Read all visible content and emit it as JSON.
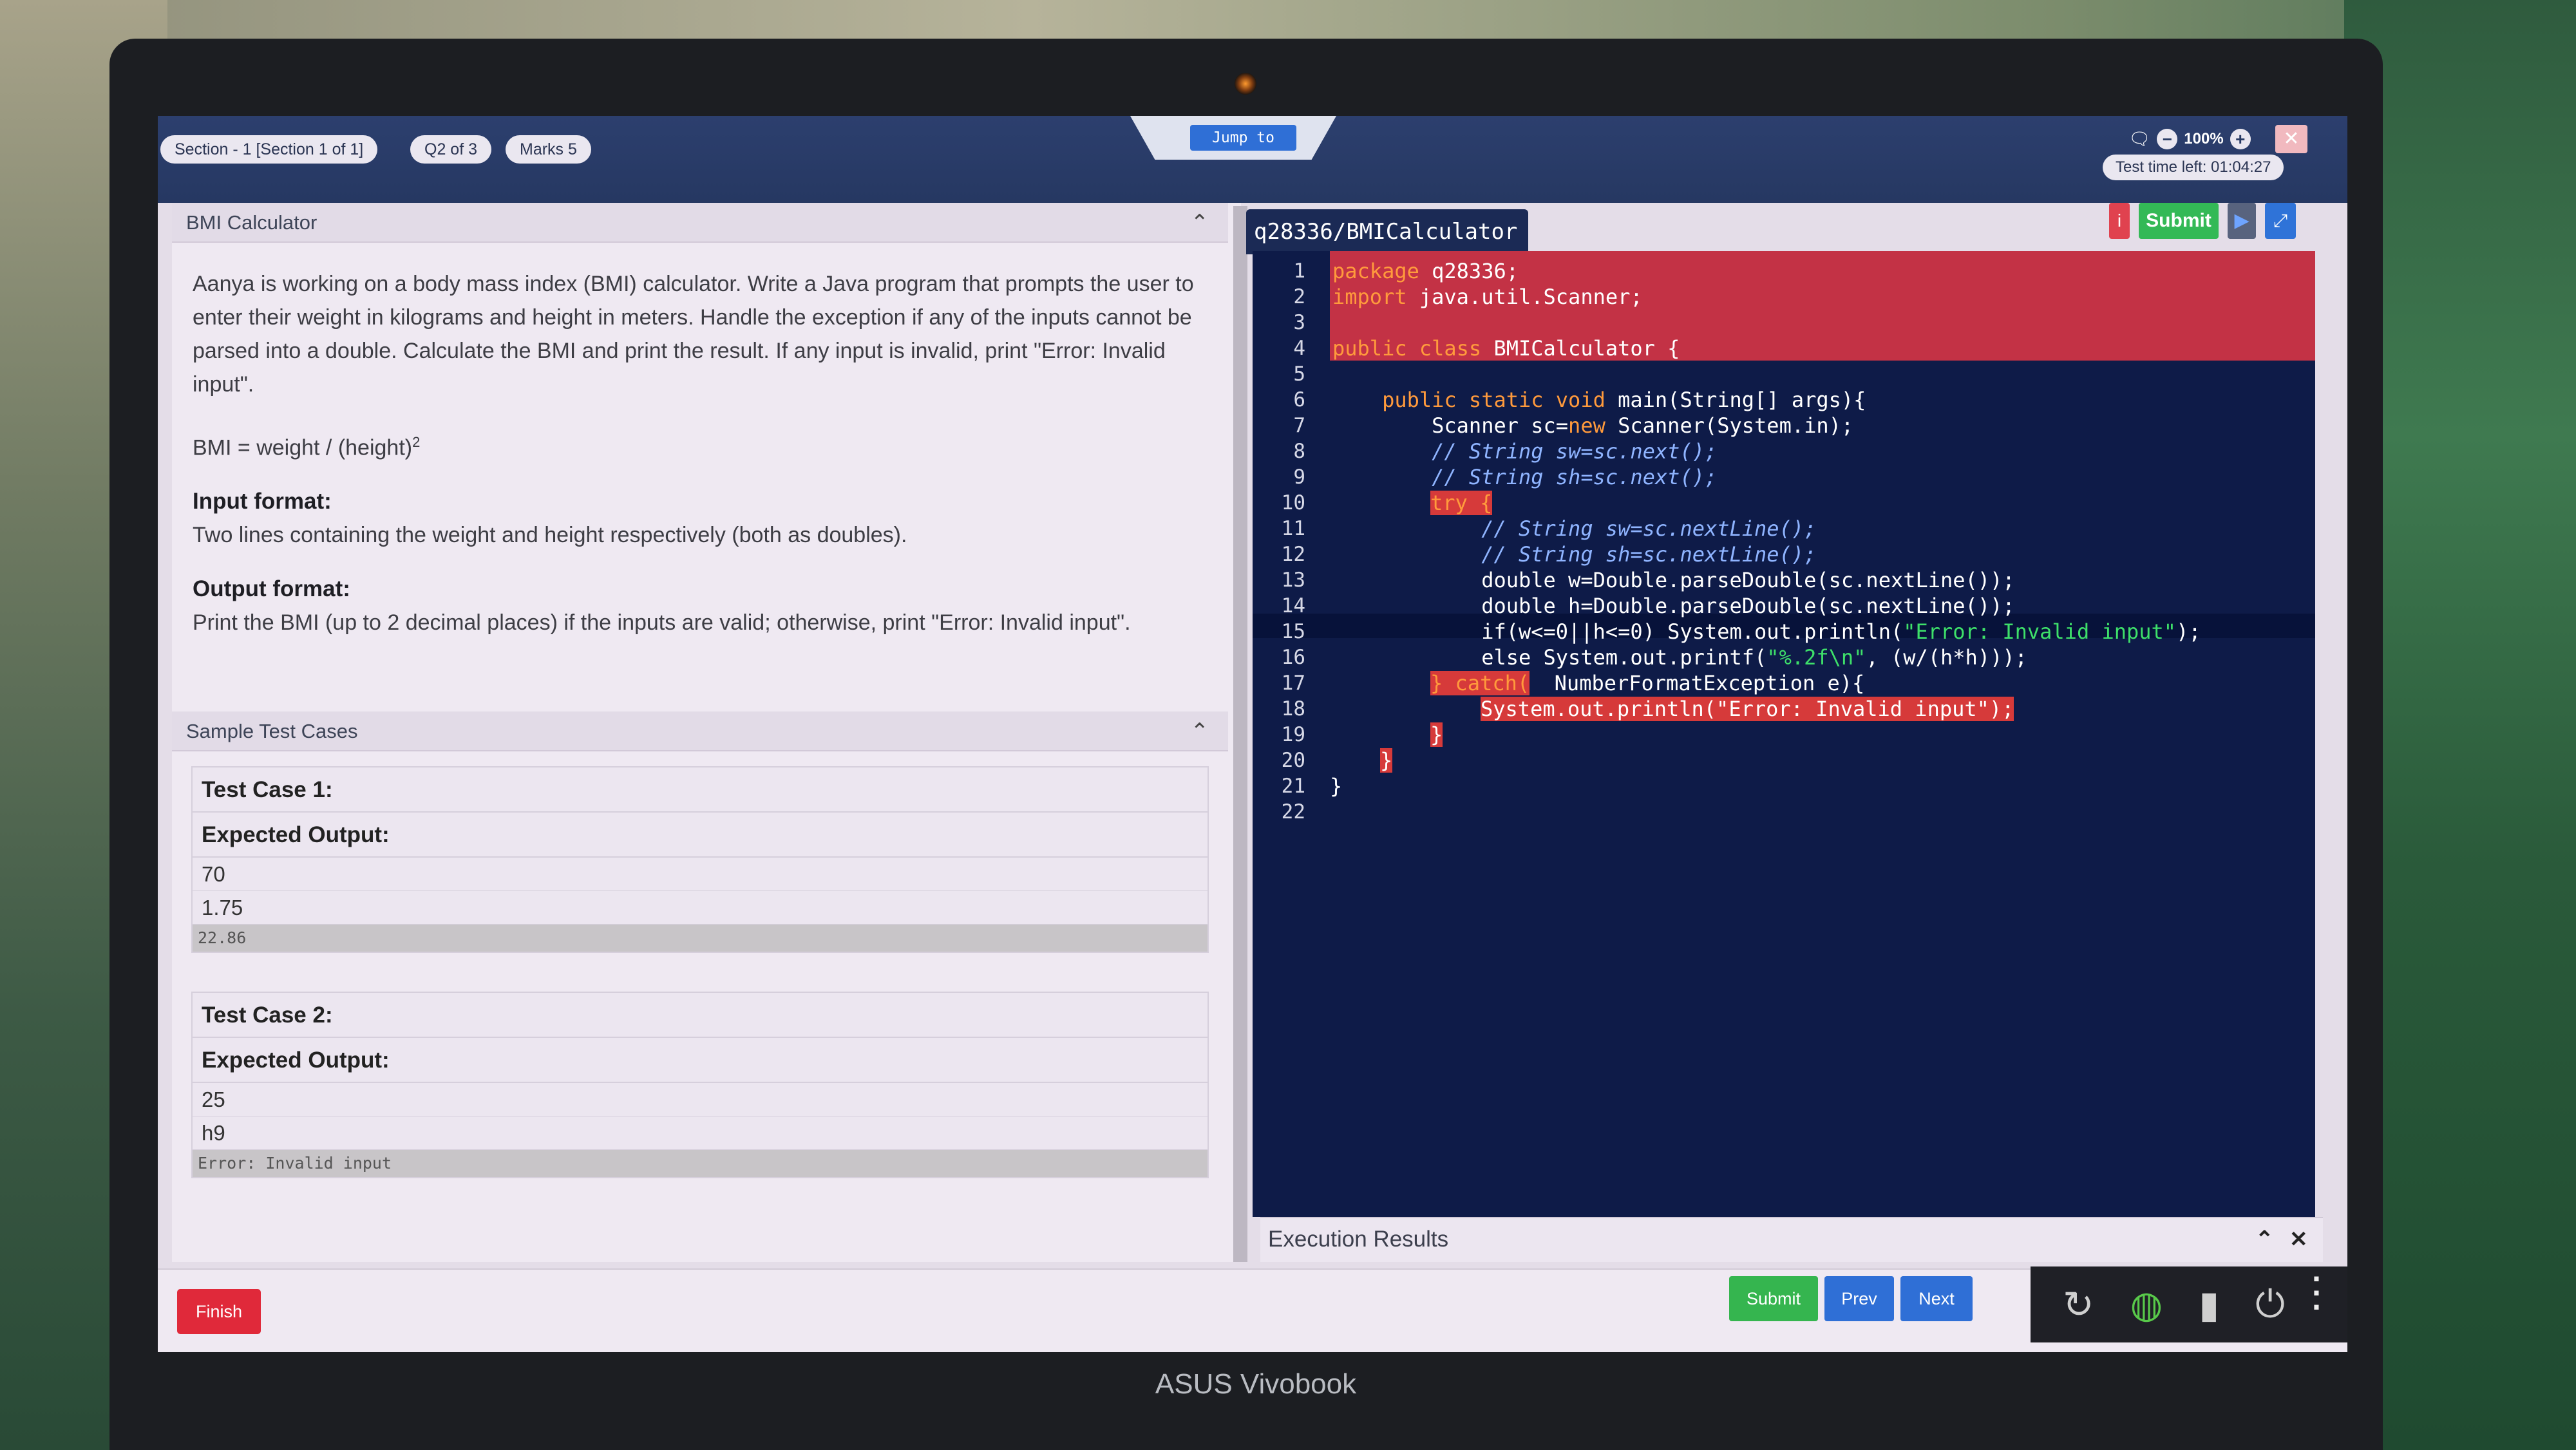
{
  "header": {
    "section": "Section - 1 [Section 1 of 1]",
    "question": "Q2 of 3",
    "marks": "Marks 5",
    "jump_label": "Jump to",
    "zoom": "100%",
    "timer": "Test time left: 01:04:27"
  },
  "question_panel": {
    "title": "BMI Calculator",
    "description": "Aanya is working on a body mass index (BMI) calculator. Write a Java program that prompts the user to enter their weight in kilograms and height in meters. Handle the exception if any of the inputs cannot be parsed into a double. Calculate the BMI and print the result. If any input is invalid, print \"Error: Invalid input\".",
    "formula": "BMI = weight / (height)",
    "formula_exp": "2",
    "input_heading": "Input format:",
    "input_text": "Two lines containing the weight and height respectively (both as doubles).",
    "output_heading": "Output format:",
    "output_text": "Print the BMI (up to 2 decimal places) if the inputs are valid; otherwise, print \"Error: Invalid input\"."
  },
  "samples": {
    "title": "Sample Test Cases",
    "expected_label": "Expected Output:",
    "cases": [
      {
        "name": "Test Case 1:",
        "inputs": [
          "70",
          "1.75"
        ],
        "output": "22.86"
      },
      {
        "name": "Test Case 2:",
        "inputs": [
          "25",
          "h9"
        ],
        "output": "Error: Invalid input"
      }
    ]
  },
  "editor": {
    "file_tab": "q28336/BMICalculator",
    "info_label": "i",
    "submit_label": "Submit",
    "line_numbers": [
      "1",
      "2",
      "3",
      "4",
      "5",
      "6",
      "7",
      "8",
      "9",
      "10",
      "11",
      "12",
      "13",
      "14",
      "15",
      "16",
      "17",
      "18",
      "19",
      "20",
      "21",
      "22"
    ],
    "code": {
      "l1a": "package",
      "l1b": " q28336;",
      "l2a": "import",
      "l2b": " java.util.Scanner;",
      "l4a": "public class",
      "l4b": " BMICalculator {",
      "l6a": "    public static void",
      "l6b": " main(String[] args){",
      "l7a": "        Scanner sc=",
      "l7b": "new",
      "l7c": " Scanner(System.in);",
      "l8": "        // String sw=sc.next();",
      "l9": "        // String sh=sc.next();",
      "l10": "try {",
      "l11": "            // String sw=sc.nextLine();",
      "l12": "            // String sh=sc.nextLine();",
      "l13": "            double w=Double.parseDouble(sc.nextLine());",
      "l14": "            double h=Double.parseDouble(sc.nextLine());",
      "l15a": "            if(w<=0||h<=0) System.out.println(",
      "l15b": "\"Error: Invalid input\"",
      "l15c": ");",
      "l16a": "            else System.out.printf(",
      "l16b": "\"%.2f\\n\"",
      "l16c": ", (w/(h*h)));",
      "l17a": "} catch(",
      "l17b": "  NumberFormatException e){",
      "l18": "System.out.println(\"Error: Invalid input\");",
      "l19": "}",
      "l20": "}",
      "l21": "}"
    }
  },
  "execution": {
    "title": "Execution Results"
  },
  "footer": {
    "finish": "Finish",
    "submit": "Submit",
    "prev": "Prev",
    "next": "Next"
  },
  "laptop": {
    "brand": "ASUS Vivobook"
  },
  "colors": {
    "header_bg": "#263862",
    "editor_bg": "#0e1b48",
    "error_red": "#c33245",
    "submit_green": "#33b956",
    "nav_blue": "#2f6fd6",
    "finish_red": "#e0293a"
  }
}
